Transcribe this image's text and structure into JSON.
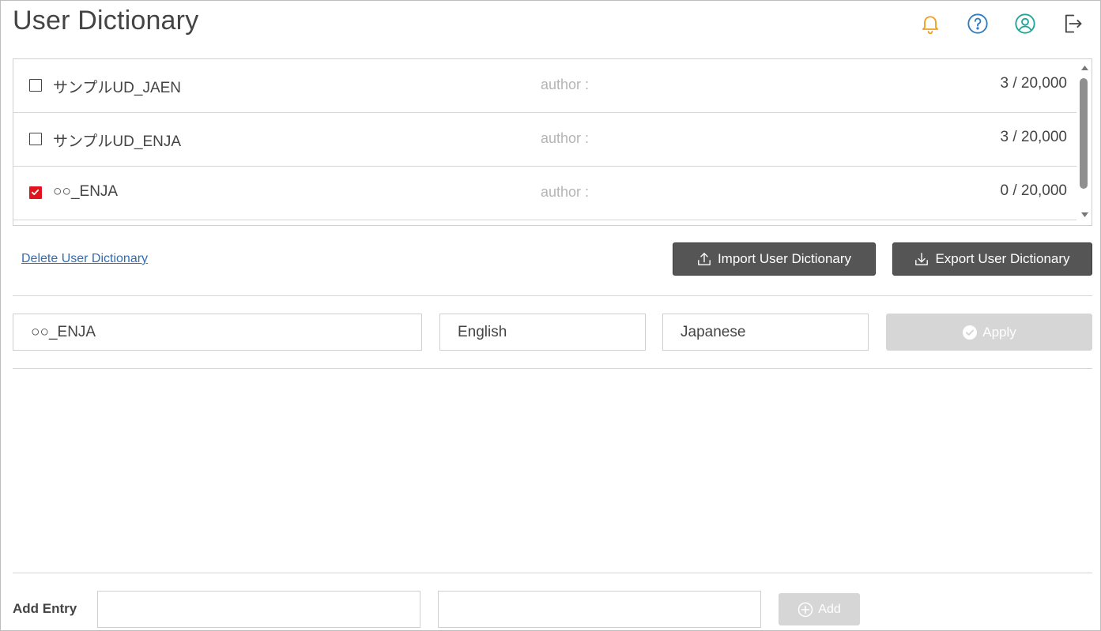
{
  "page": {
    "title": "User Dictionary"
  },
  "header_icons": [
    {
      "name": "bell-icon",
      "color": "#f0a020"
    },
    {
      "name": "help-icon",
      "color": "#2f7cc0"
    },
    {
      "name": "user-icon",
      "color": "#1ea69a"
    },
    {
      "name": "logout-icon",
      "color": "#444444"
    }
  ],
  "dictionaries": [
    {
      "name": "サンプルUD_JAEN",
      "author_label": "author :",
      "count": "3 / 20,000",
      "checked": false
    },
    {
      "name": "サンプルUD_ENJA",
      "author_label": "author :",
      "count": "3 / 20,000",
      "checked": false
    },
    {
      "name": "○○_ENJA",
      "author_label": "author :",
      "count": "0 / 20,000",
      "checked": true
    }
  ],
  "actions": {
    "delete_label": "Delete User Dictionary",
    "import_label": "Import User Dictionary",
    "export_label": "Export User Dictionary"
  },
  "editor": {
    "dictionary_name": "○○_ENJA",
    "source_language": "English",
    "target_language": "Japanese",
    "apply_label": "Apply"
  },
  "add_entry": {
    "label": "Add Entry",
    "source_value": "",
    "target_value": "",
    "add_label": "Add"
  },
  "colors": {
    "checked": "#e0141e",
    "dark_button": "#555555",
    "disabled_button": "#d6d6d6",
    "link": "#2f6eb5"
  }
}
